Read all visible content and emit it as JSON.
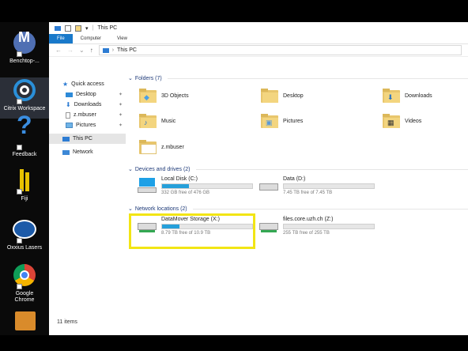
{
  "desktop": {
    "icons": [
      {
        "label": "Benchtop-...",
        "icon": "benchtop-icon"
      },
      {
        "label": "Citrix Workspace",
        "icon": "citrix-workspace-icon"
      },
      {
        "label": "Feedback",
        "icon": "question-mark-icon"
      },
      {
        "label": "Fiji",
        "icon": "fiji-icon"
      },
      {
        "label": "Oxxius Lasers",
        "icon": "oxxius-lasers-icon"
      },
      {
        "label": "Google Chrome",
        "icon": "chrome-icon"
      }
    ]
  },
  "window": {
    "title": "This PC",
    "ribbon_tabs": [
      "File",
      "Computer",
      "View"
    ],
    "address": "This PC"
  },
  "nav": {
    "items": [
      "Quick access",
      "Desktop",
      "Downloads",
      "z.mbuser",
      "Pictures",
      "This PC",
      "Network"
    ]
  },
  "groups": {
    "folders": "Folders (7)",
    "devices": "Devices and drives (2)",
    "network": "Network locations (2)"
  },
  "folders": [
    "3D Objects",
    "Desktop",
    "Downloads",
    "Music",
    "Pictures",
    "Videos",
    "z.mbuser"
  ],
  "drives": [
    {
      "name": "Local Disk (C:)",
      "free": "332 GB free of 476 GB",
      "used_fraction": 0.3
    },
    {
      "name": "Data (D:)",
      "free": "7.45 TB free of 7.45 TB",
      "used_fraction": 0.0
    }
  ],
  "network_drives": [
    {
      "name": "DataMover Storage (X:)",
      "free": "8.79 TB free of 10.9 TB",
      "used_fraction": 0.19
    },
    {
      "name": "files.core.uzh.ch (Z:)",
      "free": "255 TB free of 255 TB",
      "used_fraction": 0.0
    }
  ],
  "status": "11 items",
  "colors": {
    "accent": "#1979ca",
    "bar_fill": "#26a0da",
    "highlight": "#f2e514",
    "folder": "#f3d57f"
  }
}
